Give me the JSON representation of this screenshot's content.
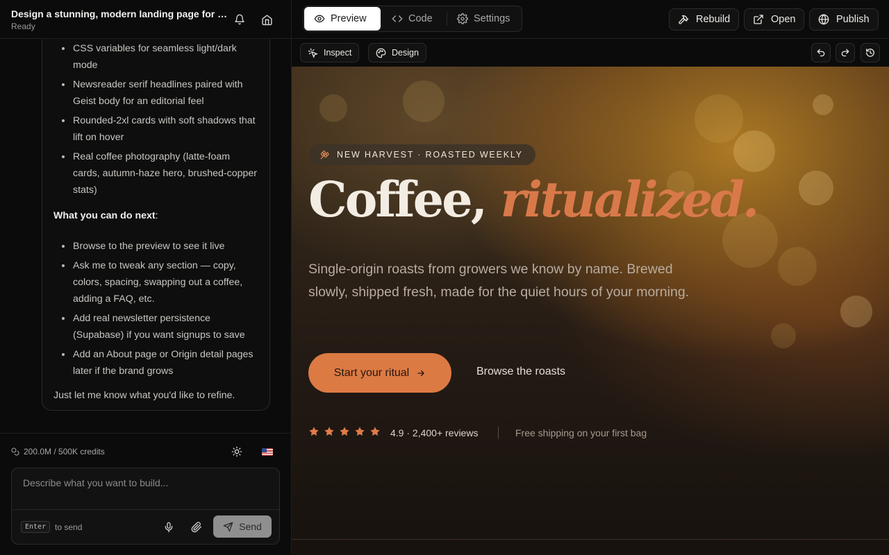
{
  "header": {
    "title": "Design a stunning, modern landing page for a premium coffee brand",
    "status": "Ready",
    "icons": [
      "bell-icon",
      "home-icon"
    ]
  },
  "chat": {
    "list1": [
      "CSS variables for seamless light/dark mode",
      "Newsreader serif headlines paired with Geist body for an editorial feel",
      "Rounded-2xl cards with soft shadows that lift on hover",
      "Real coffee photography (latte-foam cards, autumn-haze hero, brushed-copper stats)"
    ],
    "next_heading": "What you can do next",
    "next_colon": ":",
    "list2": [
      "Browse to the preview to see it live",
      "Ask me to tweak any section — copy, colors, spacing, swapping out a coffee, adding a FAQ, etc.",
      "Add real newsletter persistence (Supabase) if you want signups to save",
      "Add an About page or Origin detail pages later if the brand grows"
    ],
    "footer": "Just let me know what you'd like to refine."
  },
  "composer": {
    "credits": "200.0M / 500K credits",
    "placeholder": "Describe what you want to build...",
    "enter_key": "Enter",
    "enter_hint": "to send",
    "send_label": "Send"
  },
  "topbar": {
    "tabs": [
      {
        "label": "Preview",
        "icon": "eye-icon",
        "active": true
      },
      {
        "label": "Code",
        "icon": "code-icon",
        "active": false
      },
      {
        "label": "Settings",
        "icon": "gear-icon",
        "active": false
      }
    ],
    "actions": {
      "rebuild": "Rebuild",
      "open": "Open",
      "publish": "Publish"
    }
  },
  "toolbar": {
    "inspect": "Inspect",
    "design": "Design"
  },
  "preview": {
    "badge": "NEW HARVEST · ROASTED WEEKLY",
    "headline_plain": "Coffee,",
    "headline_accent": "ritualized.",
    "subheadline": "Single-origin roasts from growers we know by name. Brewed slowly, shipped fresh, made for the quiet hours of your morning.",
    "cta_primary": "Start your ritual",
    "cta_secondary": "Browse the roasts",
    "rating_stars": 5,
    "rating_text": "4.9 · 2,400+ reviews",
    "shipping_note": "Free shipping on your first bag"
  },
  "colors": {
    "accent": "#dc7a44",
    "headline_accent": "#d9794a",
    "panel_bg": "#0b0b0b",
    "star": "#e07c48"
  }
}
